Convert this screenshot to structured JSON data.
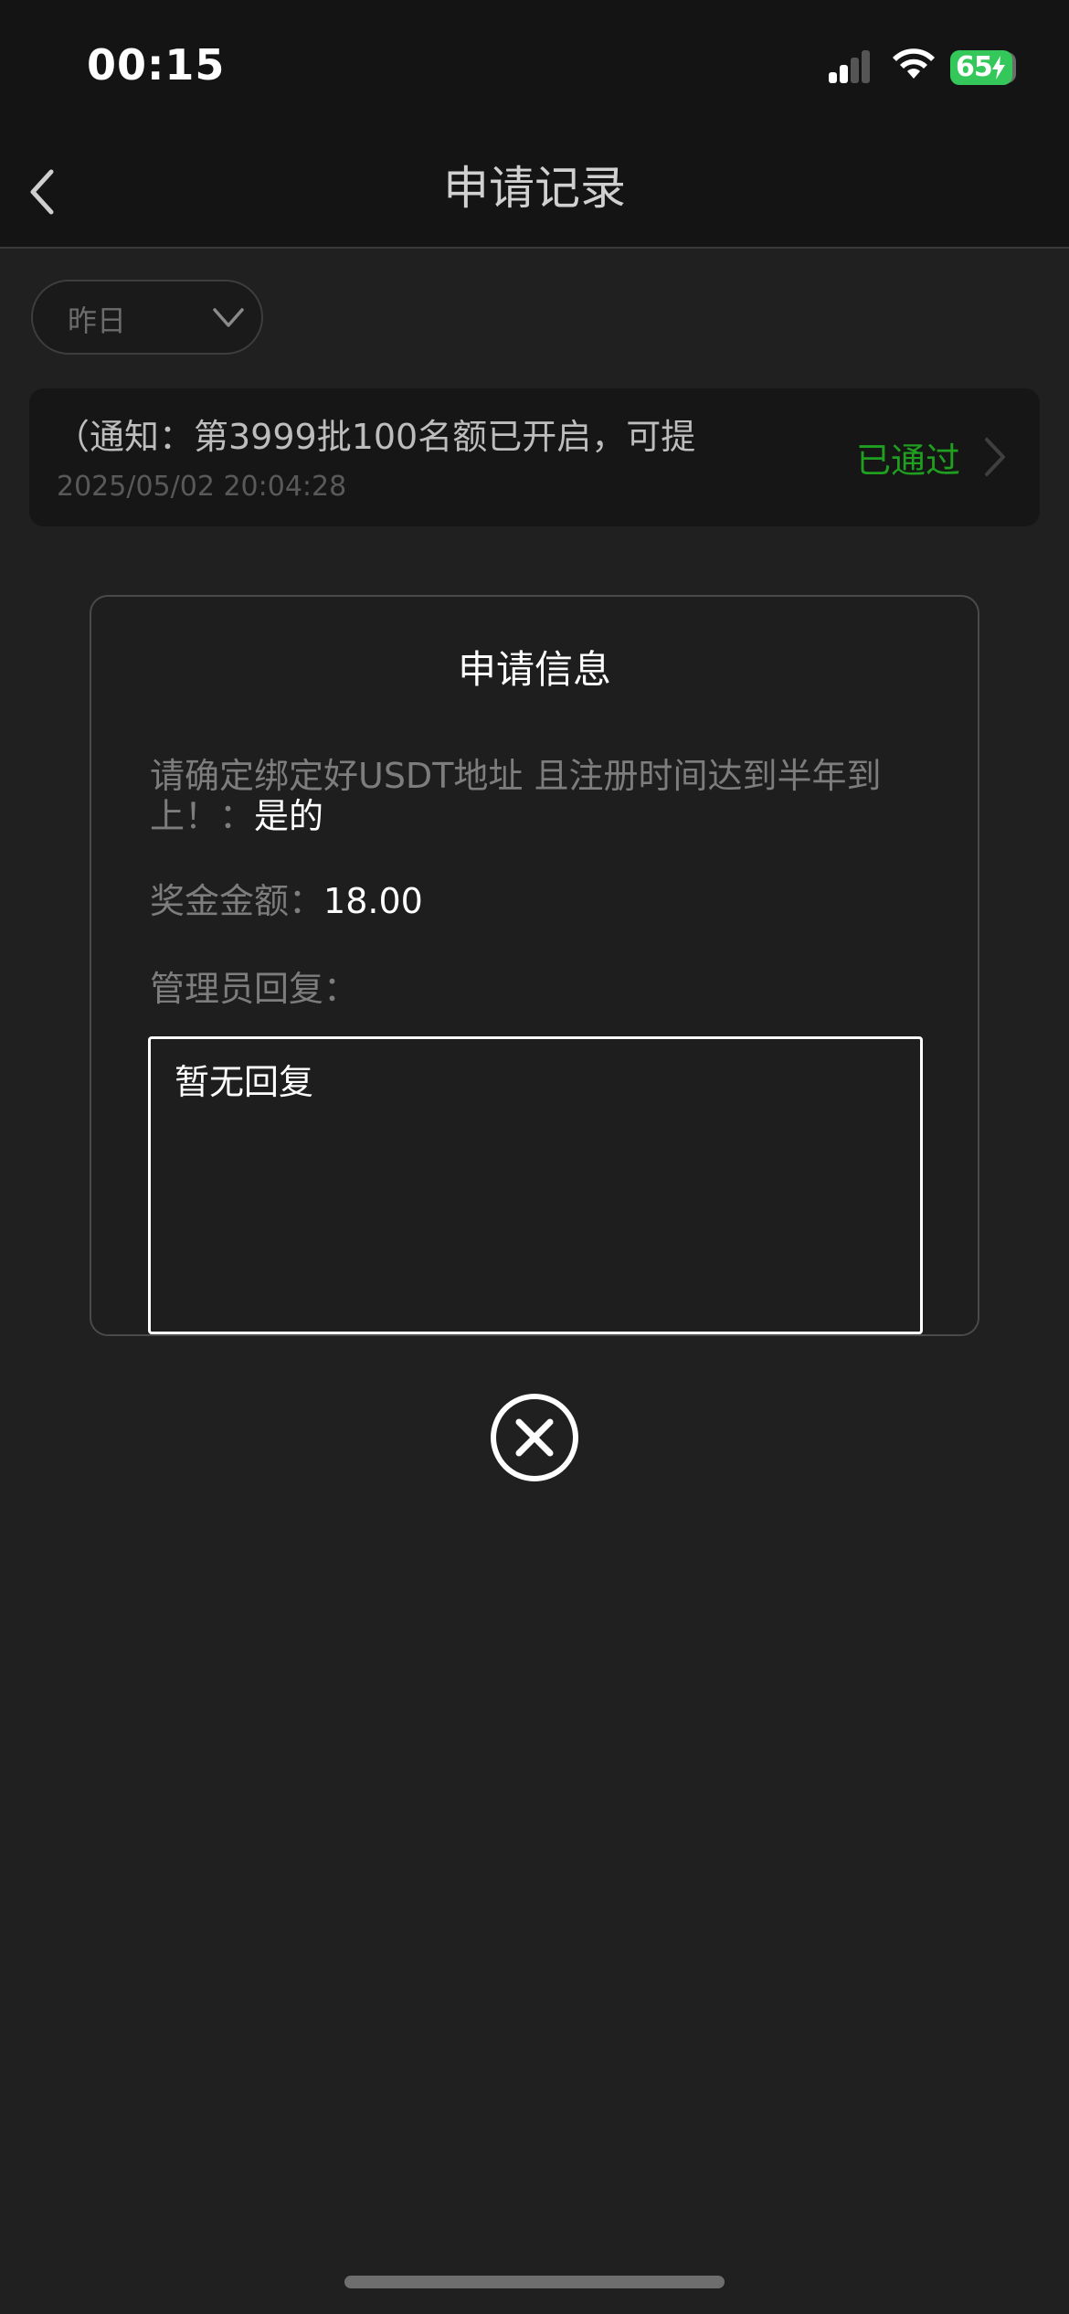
{
  "status_bar": {
    "time": "00:15",
    "battery": "65",
    "battery_color": "#34c759"
  },
  "navbar": {
    "back_icon": "chevron-left-icon",
    "title": "申请记录"
  },
  "filter": {
    "selected": "昨日",
    "icon": "chevron-down-icon"
  },
  "record": {
    "title": "（通知：第3999批100名额已开启，可提",
    "time": "2025/05/02 20:04:28",
    "status": "已通过",
    "status_color": "#1f9e1f"
  },
  "modal": {
    "title": "申请信息",
    "question_label": "请确定绑定好USDT地址 且注册时间达到半年到上！：",
    "question_answer": "是的",
    "amount_label": "奖金金额：",
    "amount_value": "18.00",
    "reply_label": "管理员回复：",
    "reply_text": "暂无回复"
  },
  "close": {
    "icon": "close-circle-icon"
  }
}
